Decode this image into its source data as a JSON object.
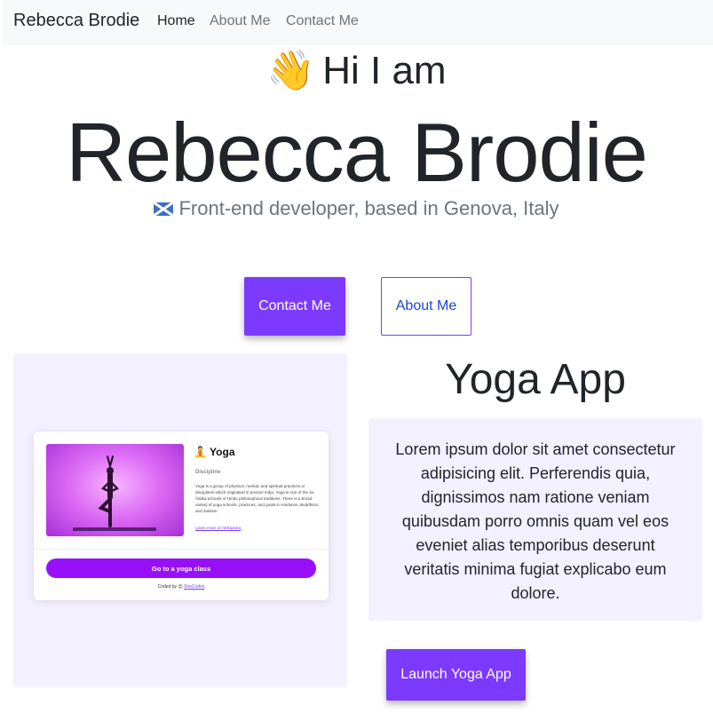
{
  "navbar": {
    "brand": "Rebecca Brodie",
    "links": [
      "Home",
      "About Me",
      "Contact Me"
    ]
  },
  "hero": {
    "wave_emoji": "👋",
    "greeting": "Hi I am",
    "name": "Rebecca Brodie",
    "flag_icon": "scotland-flag-icon",
    "tagline": "Front-end developer, based in Genova, Italy"
  },
  "cta": {
    "contact_label": "Contact Me",
    "about_label": "About Me"
  },
  "project": {
    "title": "Yoga App",
    "description": "Lorem ipsum dolor sit amet consectetur adipisicing elit. Perferendis quia, dignissimos nam ratione veniam quibusdam porro omnis quam vel eos eveniet alias temporibus deserunt veritatis minima fugiat explicabo eum dolore.",
    "launch_label": "Launch Yoga App",
    "preview": {
      "title": "🧘 Yoga",
      "subtitle": "Discipline",
      "text": "Yoga is a group of physical, mental, and spiritual practices or disciplines which originated in ancient India. Yoga is one of the six Āstika schools of Hindu philosophical traditions. There is a broad variety of yoga schools, practices, and goals in Hinduism, Buddhism, and Jainism.",
      "link": "Learn more on Wikipedia",
      "button": "Go to a yoga class",
      "footer_prefix": "Coded by 😊",
      "footer_link": "SheCodes"
    }
  },
  "colors": {
    "accent": "#7c3aff",
    "panel_bg": "#f3f0ff",
    "navbar_bg": "#f8f9fa"
  }
}
